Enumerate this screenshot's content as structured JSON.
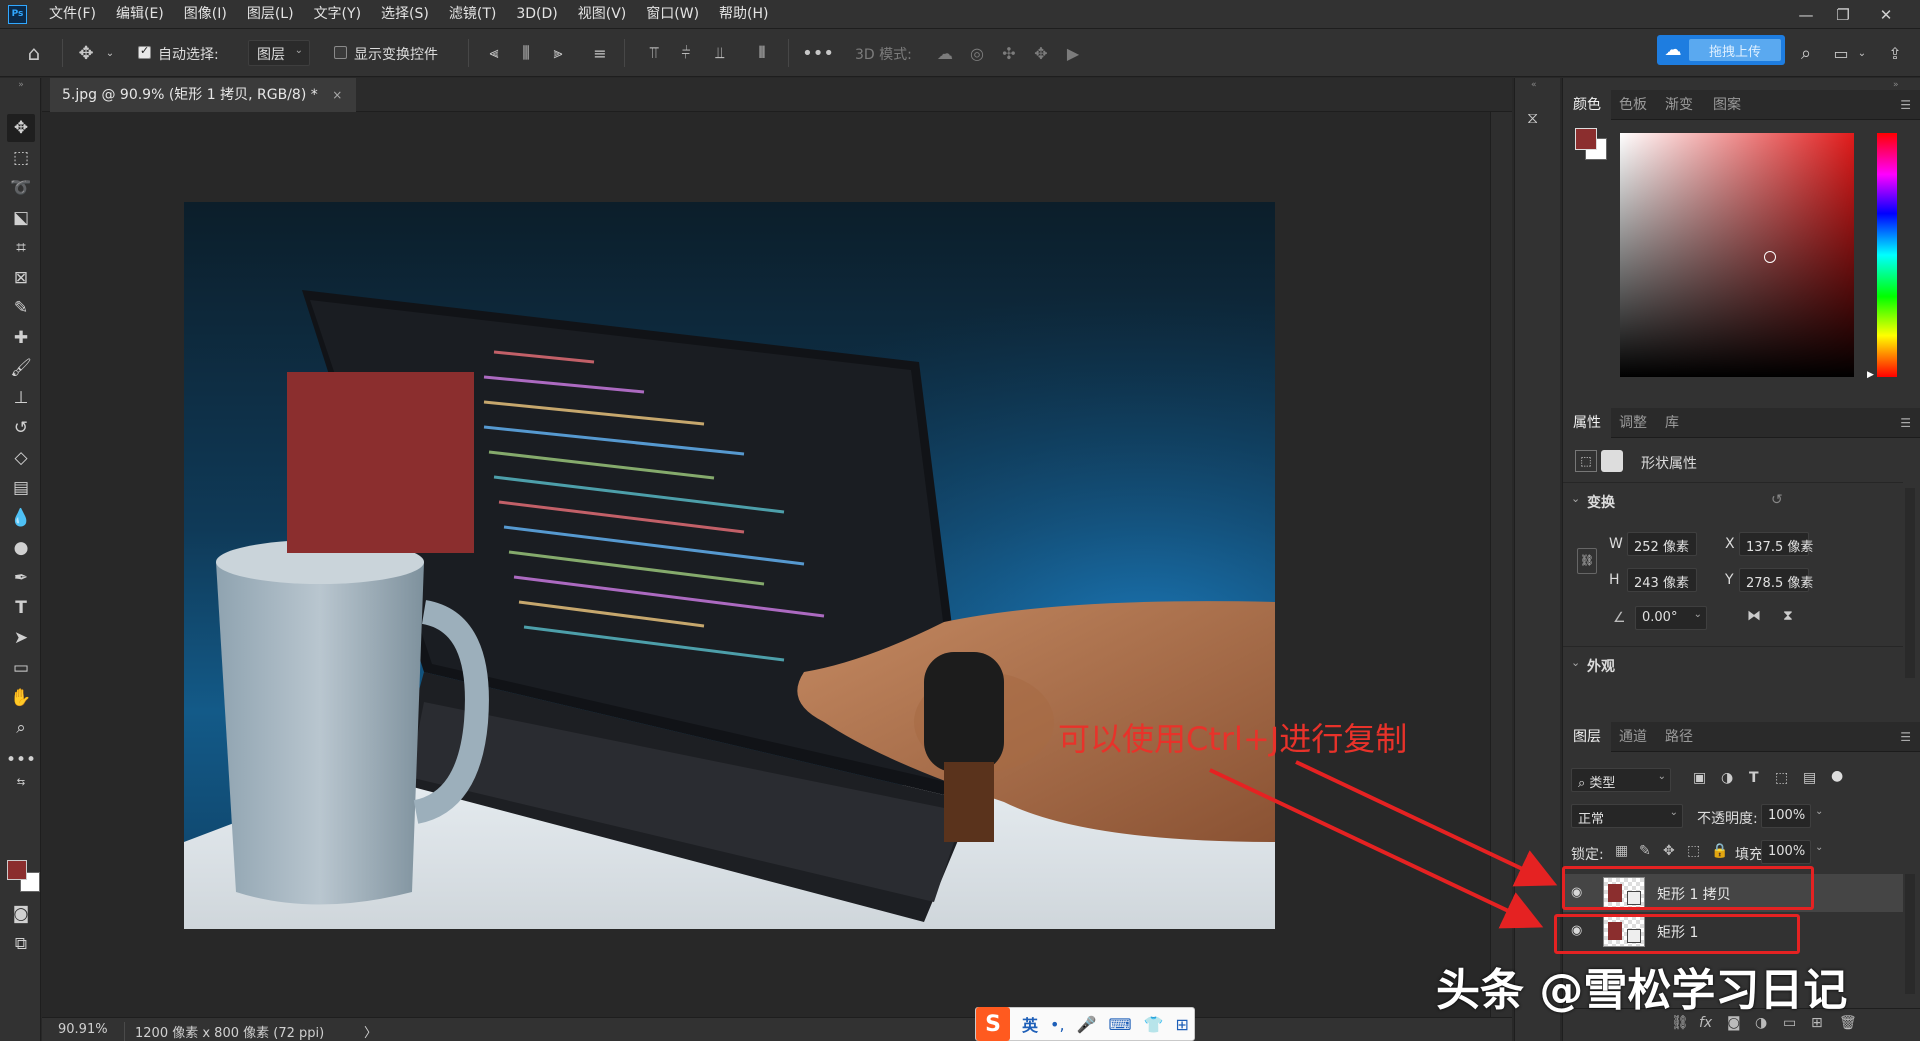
{
  "menu": {
    "logo": "Ps",
    "items": [
      "文件(F)",
      "编辑(E)",
      "图像(I)",
      "图层(L)",
      "文字(Y)",
      "选择(S)",
      "滤镜(T)",
      "3D(D)",
      "视图(V)",
      "窗口(W)",
      "帮助(H)"
    ]
  },
  "options": {
    "auto_select_label": "自动选择:",
    "auto_select_value": "图层",
    "show_transform_label": "显示变换控件",
    "mode_3d_label": "3D 模式:",
    "upload_label": "拖拽上传"
  },
  "document": {
    "tab_title": "5.jpg @ 90.9% (矩形 1 拷贝, RGB/8) *",
    "close": "×"
  },
  "status": {
    "zoom": "90.91%",
    "doc_info": "1200 像素 x 800 像素 (72 ppi)",
    "arrow": "〉"
  },
  "color_panel": {
    "tabs": [
      "颜色",
      "色板",
      "渐变",
      "图案"
    ],
    "foreground": "#8b2e2e",
    "background": "#ffffff"
  },
  "properties_panel": {
    "tabs": [
      "属性",
      "调整",
      "库"
    ],
    "kind": "形状属性",
    "transform_section": "变换",
    "w_label": "W",
    "w_value": "252 像素",
    "h_label": "H",
    "h_value": "243 像素",
    "x_label": "X",
    "x_value": "137.5 像素",
    "y_label": "Y",
    "y_value": "278.5 像素",
    "angle_value": "0.00°",
    "appearance_section": "外观"
  },
  "layers_panel": {
    "tabs": [
      "图层",
      "通道",
      "路径"
    ],
    "filter_label": "类型",
    "blend_mode": "正常",
    "opacity_label": "不透明度:",
    "opacity_value": "100%",
    "lock_label": "锁定:",
    "fill_label": "填充:",
    "fill_value": "100%",
    "layers": [
      {
        "name": "矩形 1 拷贝",
        "selected": true
      },
      {
        "name": "矩形 1",
        "selected": false
      }
    ]
  },
  "annotation": {
    "text": "可以使用Ctrl+J进行复制",
    "color": "#e8322a"
  },
  "watermark": "头条 @雪松学习日记",
  "ime": {
    "logo": "S",
    "items": [
      "英",
      "•,",
      "🎤",
      "⌨",
      "👕",
      "⊞"
    ]
  }
}
